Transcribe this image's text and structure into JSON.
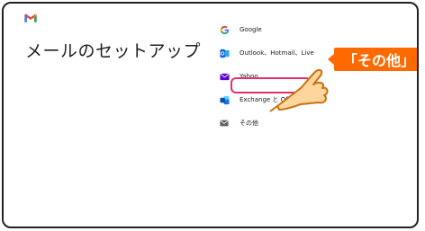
{
  "page": {
    "title": "メールのセットアップ"
  },
  "providers": [
    {
      "icon": "google-g-icon",
      "label": "Google"
    },
    {
      "icon": "outlook-icon",
      "label": "Outlook、Hotmail、Live"
    },
    {
      "icon": "yahoo-mail-icon",
      "label": "Yahoo"
    },
    {
      "icon": "exchange-office365-icon",
      "label": "Exchange と Office 365"
    },
    {
      "icon": "other-mail-icon",
      "label": "その他"
    }
  ],
  "callout": {
    "text": "「その他」"
  },
  "colors": {
    "highlight": "#e0306b",
    "callout": "#ff6a00",
    "yahoo": "#5f01d1",
    "outlook": "#0a64d8",
    "exchange": "#1a73e8"
  }
}
